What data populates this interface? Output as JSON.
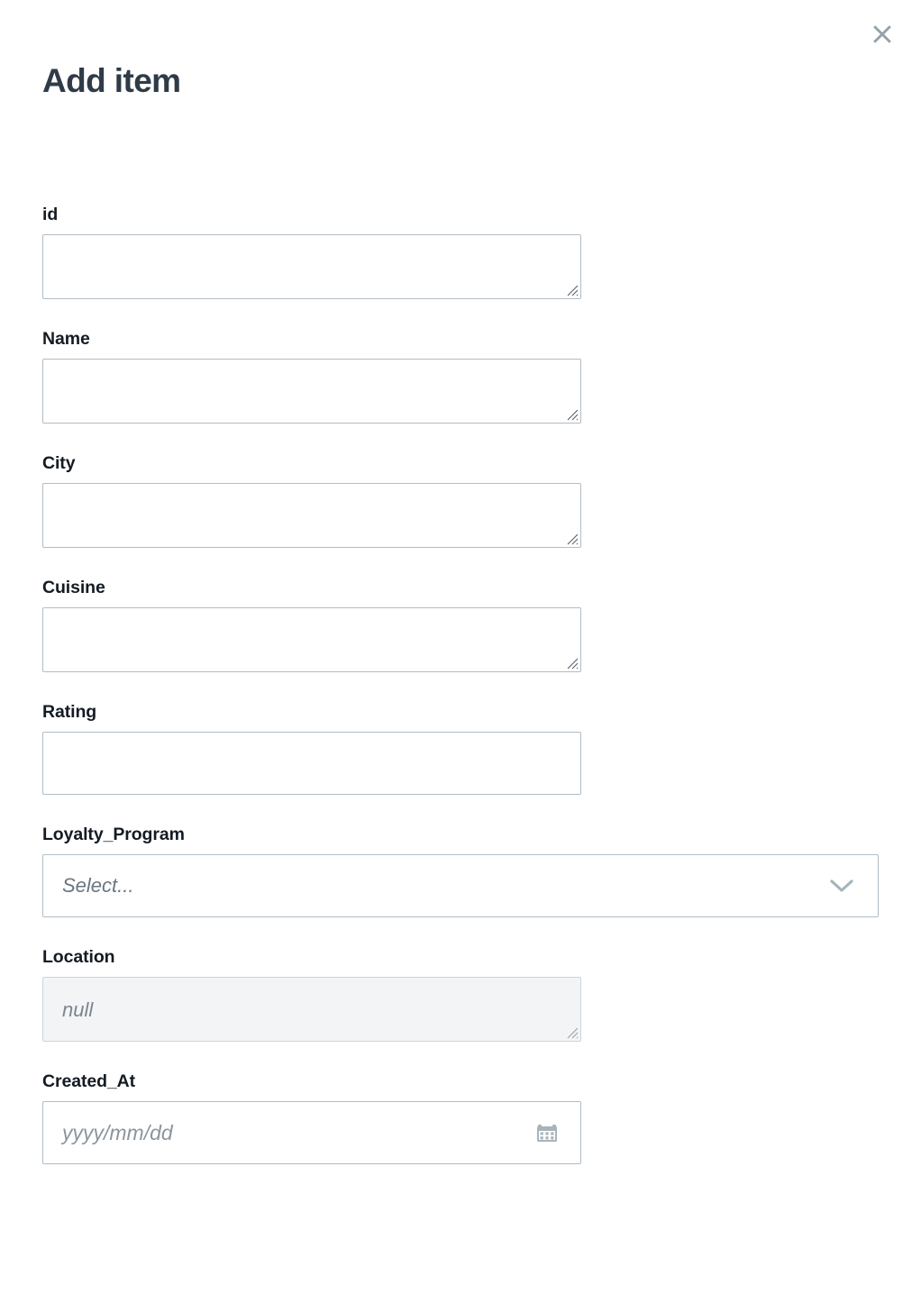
{
  "modal": {
    "title": "Add item",
    "close_icon": "close-icon",
    "close_label": "Close"
  },
  "colors": {
    "title_text": "#2f3b47",
    "label_text": "#141b23",
    "border": "#b1bdc5",
    "disabled_bg": "#f2f4f6",
    "placeholder_text": "#6b7680",
    "icon_gray": "#93a0a9",
    "background": "#ffffff"
  },
  "form": {
    "fields": [
      {
        "label": "id",
        "name": "id",
        "type": "textarea",
        "value": "",
        "placeholder": "",
        "disabled": false,
        "resizable": true
      },
      {
        "label": "Name",
        "name": "name",
        "type": "textarea",
        "value": "",
        "placeholder": "",
        "disabled": false,
        "resizable": true
      },
      {
        "label": "City",
        "name": "city",
        "type": "textarea",
        "value": "",
        "placeholder": "",
        "disabled": false,
        "resizable": true
      },
      {
        "label": "Cuisine",
        "name": "cuisine",
        "type": "textarea",
        "value": "",
        "placeholder": "",
        "disabled": false,
        "resizable": true
      },
      {
        "label": "Rating",
        "name": "rating",
        "type": "input",
        "value": "",
        "placeholder": "",
        "disabled": false,
        "resizable": false
      },
      {
        "label": "Loyalty_Program",
        "name": "loyalty_program",
        "type": "select",
        "value": "",
        "placeholder": "Select...",
        "disabled": false,
        "resizable": false,
        "icon": "chevron-down-icon"
      },
      {
        "label": "Location",
        "name": "location",
        "type": "textarea",
        "value": "",
        "placeholder": "null",
        "disabled": true,
        "resizable": true
      },
      {
        "label": "Created_At",
        "name": "created_at",
        "type": "date",
        "value": "",
        "placeholder": "yyyy/mm/dd",
        "disabled": false,
        "resizable": false,
        "icon": "calendar-icon"
      }
    ]
  }
}
